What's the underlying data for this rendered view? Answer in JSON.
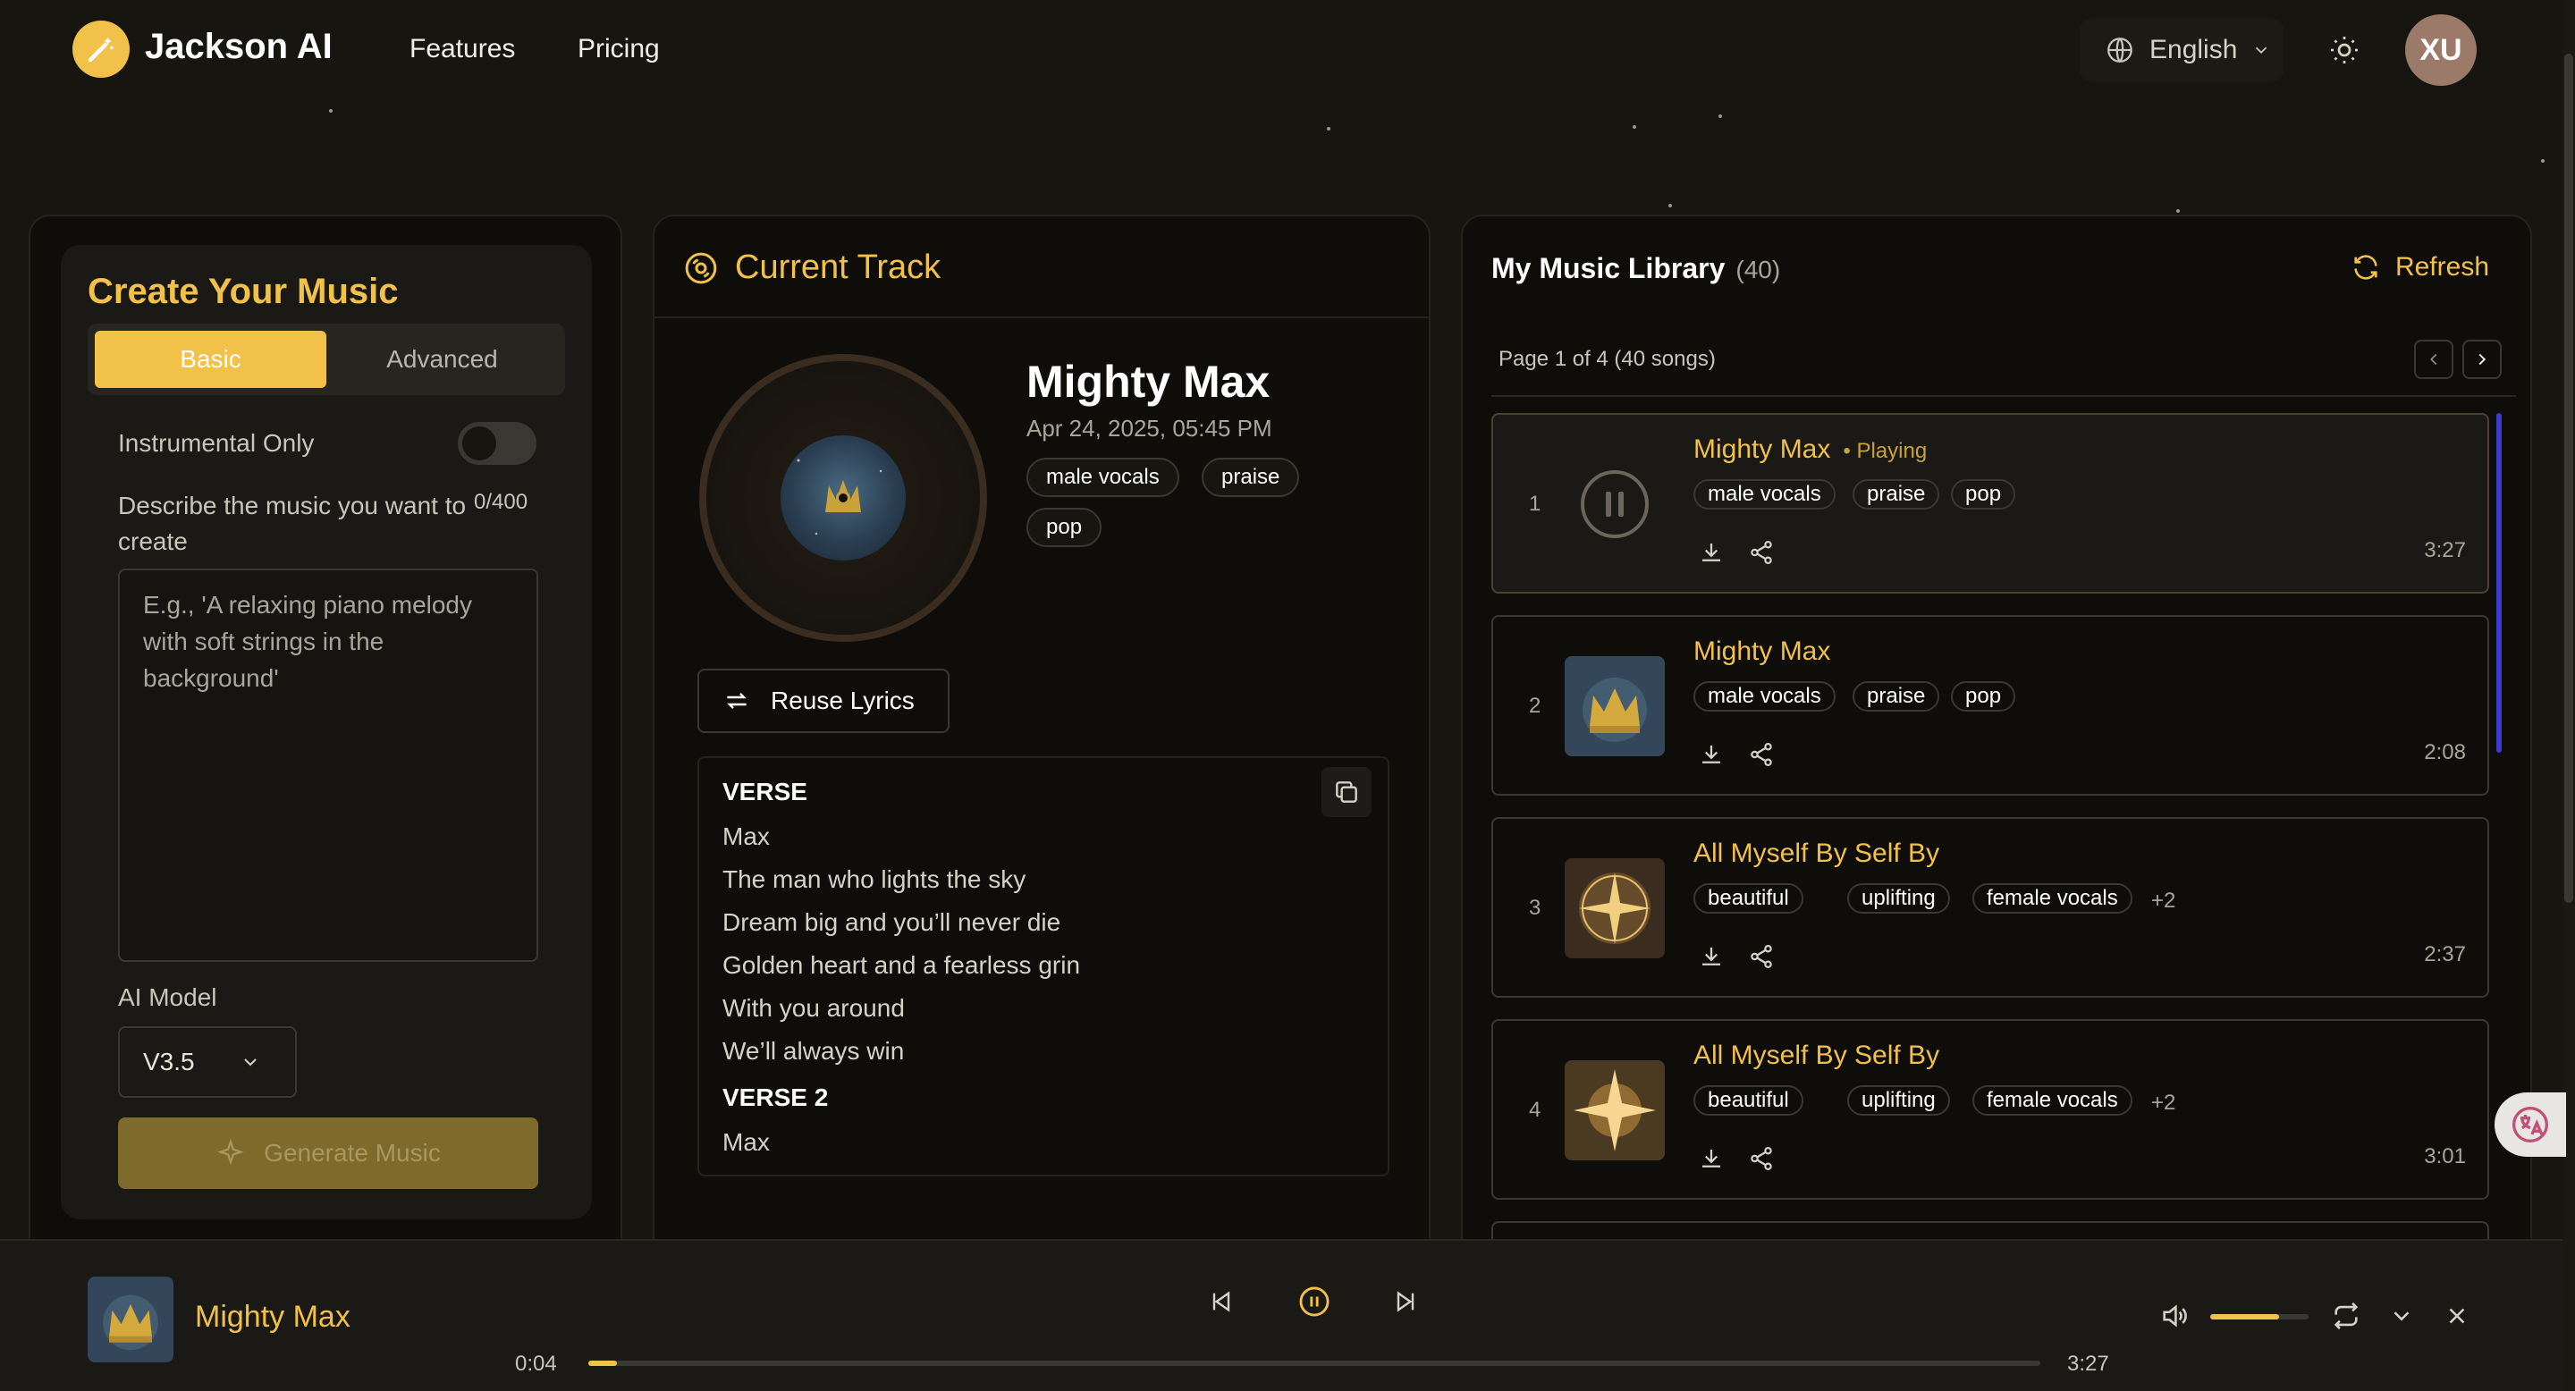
{
  "header": {
    "logo": "Jackson AI",
    "nav": [
      "Features",
      "Pricing"
    ],
    "language": "English",
    "avatar": "XU"
  },
  "create": {
    "title": "Create Your Music",
    "tabs": [
      "Basic",
      "Advanced"
    ],
    "active_tab": "Basic",
    "instrumental_label": "Instrumental Only",
    "instrumental_on": false,
    "describe_label": "Describe the music you want to create",
    "counter": "0/400",
    "placeholder": "E.g., 'A relaxing piano melody with soft strings in the background'",
    "model_label": "AI Model",
    "model_value": "V3.5",
    "generate_label": "Generate Music"
  },
  "current": {
    "heading": "Current Track",
    "title": "Mighty Max",
    "date": "Apr 24, 2025, 05:45 PM",
    "tags": [
      "male vocals",
      "praise",
      "pop"
    ],
    "reuse_label": "Reuse Lyrics",
    "lyrics": [
      {
        "head": "VERSE",
        "lines": [
          "Max",
          "The man who lights the sky",
          "Dream big and you’ll never die",
          "Golden heart and a fearless grin",
          "With you around",
          "We’ll always win"
        ]
      },
      {
        "head": "VERSE 2",
        "lines": [
          "Max"
        ]
      }
    ]
  },
  "library": {
    "title": "My Music Library",
    "count": "(40)",
    "refresh_label": "Refresh",
    "page_info": "Page 1 of 4 (40 songs)",
    "playing_label": "• Playing",
    "songs": [
      {
        "num": "1",
        "title": "Mighty Max",
        "tags": [
          "male vocals",
          "praise",
          "pop"
        ],
        "more": "",
        "duration": "3:27",
        "playing": true
      },
      {
        "num": "2",
        "title": "Mighty Max",
        "tags": [
          "male vocals",
          "praise",
          "pop"
        ],
        "more": "",
        "duration": "2:08",
        "playing": false
      },
      {
        "num": "3",
        "title": "All Myself By Self By",
        "tags": [
          "beautiful",
          "uplifting",
          "female vocals"
        ],
        "more": "+2",
        "duration": "2:37",
        "playing": false
      },
      {
        "num": "4",
        "title": "All Myself By Self By",
        "tags": [
          "beautiful",
          "uplifting",
          "female vocals"
        ],
        "more": "+2",
        "duration": "3:01",
        "playing": false
      }
    ]
  },
  "player": {
    "title": "Mighty Max",
    "current_time": "0:04",
    "total_time": "3:27",
    "progress": 0.02,
    "volume": 0.7
  },
  "colors": {
    "accent": "#f2c14a",
    "background": "#17150f",
    "panel": "#0e0d0a"
  }
}
